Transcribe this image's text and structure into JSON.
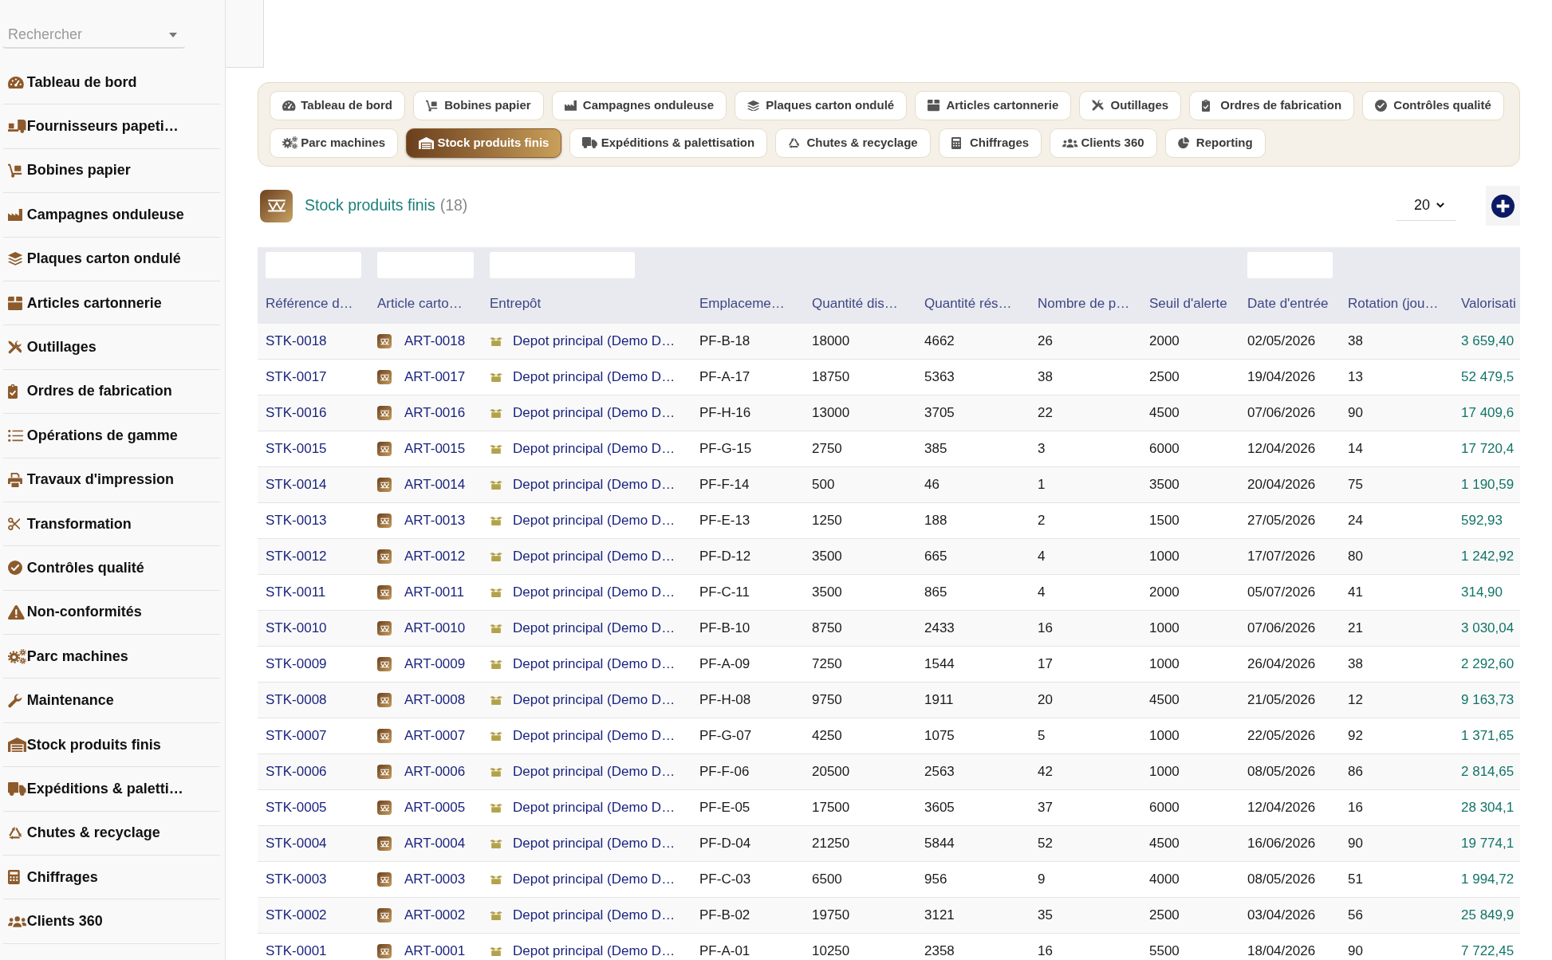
{
  "sidebar": {
    "search": {
      "placeholder": "Rechercher"
    },
    "items": [
      "Tableau de bord",
      "Fournisseurs papeti…",
      "Bobines papier",
      "Campagnes onduleuse",
      "Plaques carton ondulé",
      "Articles cartonnerie",
      "Outillages",
      "Ordres de fabrication",
      "Opérations de gamme",
      "Travaux d'impression",
      "Transformation",
      "Contrôles qualité",
      "Non-conformités",
      "Parc machines",
      "Maintenance",
      "Stock produits finis",
      "Expéditions & paletti…",
      "Chutes & recyclage",
      "Chiffrages",
      "Clients 360"
    ]
  },
  "tabs": [
    {
      "label": "Tableau de bord",
      "selected": false
    },
    {
      "label": "Bobines papier",
      "selected": false
    },
    {
      "label": "Campagnes onduleuse",
      "selected": false
    },
    {
      "label": "Plaques carton ondulé",
      "selected": false
    },
    {
      "label": "Articles cartonnerie",
      "selected": false
    },
    {
      "label": "Outillages",
      "selected": false
    },
    {
      "label": "Ordres de fabrication",
      "selected": false
    },
    {
      "label": "Contrôles qualité",
      "selected": false
    },
    {
      "label": "Parc machines",
      "selected": false
    },
    {
      "label": "Stock produits finis",
      "selected": true
    },
    {
      "label": "Expéditions & palettisation",
      "selected": false
    },
    {
      "label": "Chutes & recyclage",
      "selected": false
    },
    {
      "label": "Chiffrages",
      "selected": false
    },
    {
      "label": "Clients 360",
      "selected": false
    },
    {
      "label": "Reporting",
      "selected": false
    }
  ],
  "header": {
    "title": "Stock produits finis",
    "count": "(18)",
    "page_size": "20"
  },
  "table": {
    "columns": [
      {
        "label": "Référence d…",
        "kind": "link",
        "filter": true
      },
      {
        "label": "Article carto…",
        "kind": "article",
        "filter": true
      },
      {
        "label": "Entrepôt",
        "kind": "depot",
        "filter": true
      },
      {
        "label": "Emplaceme…",
        "kind": "text",
        "filter": false
      },
      {
        "label": "Quantité dis…",
        "kind": "text",
        "filter": false
      },
      {
        "label": "Quantité rés…",
        "kind": "text",
        "filter": false
      },
      {
        "label": "Nombre de p…",
        "kind": "text",
        "filter": false
      },
      {
        "label": "Seuil d'alerte",
        "kind": "text",
        "filter": false
      },
      {
        "label": "Date d'entrée",
        "kind": "text",
        "filter": true
      },
      {
        "label": "Rotation (jou…",
        "kind": "text",
        "filter": false
      },
      {
        "label": "Valorisati",
        "kind": "amount",
        "filter": false
      }
    ],
    "rows": [
      [
        "STK-0018",
        "ART-0018",
        "Depot principal (Demo D…",
        "PF-B-18",
        "18000",
        "4662",
        "26",
        "2000",
        "02/05/2026",
        "38",
        "3 659,40"
      ],
      [
        "STK-0017",
        "ART-0017",
        "Depot principal (Demo D…",
        "PF-A-17",
        "18750",
        "5363",
        "38",
        "2500",
        "19/04/2026",
        "13",
        "52 479,5"
      ],
      [
        "STK-0016",
        "ART-0016",
        "Depot principal (Demo D…",
        "PF-H-16",
        "13000",
        "3705",
        "22",
        "4500",
        "07/06/2026",
        "90",
        "17 409,6"
      ],
      [
        "STK-0015",
        "ART-0015",
        "Depot principal (Demo D…",
        "PF-G-15",
        "2750",
        "385",
        "3",
        "6000",
        "12/04/2026",
        "14",
        "17 720,4"
      ],
      [
        "STK-0014",
        "ART-0014",
        "Depot principal (Demo D…",
        "PF-F-14",
        "500",
        "46",
        "1",
        "3500",
        "20/04/2026",
        "75",
        "1 190,59"
      ],
      [
        "STK-0013",
        "ART-0013",
        "Depot principal (Demo D…",
        "PF-E-13",
        "1250",
        "188",
        "2",
        "1500",
        "27/05/2026",
        "24",
        "592,93"
      ],
      [
        "STK-0012",
        "ART-0012",
        "Depot principal (Demo D…",
        "PF-D-12",
        "3500",
        "665",
        "4",
        "1000",
        "17/07/2026",
        "80",
        "1 242,92"
      ],
      [
        "STK-0011",
        "ART-0011",
        "Depot principal (Demo D…",
        "PF-C-11",
        "3500",
        "865",
        "4",
        "2000",
        "05/07/2026",
        "41",
        "314,90"
      ],
      [
        "STK-0010",
        "ART-0010",
        "Depot principal (Demo D…",
        "PF-B-10",
        "8750",
        "2433",
        "16",
        "1000",
        "07/06/2026",
        "21",
        "3 030,04"
      ],
      [
        "STK-0009",
        "ART-0009",
        "Depot principal (Demo D…",
        "PF-A-09",
        "7250",
        "1544",
        "17",
        "1000",
        "26/04/2026",
        "38",
        "2 292,60"
      ],
      [
        "STK-0008",
        "ART-0008",
        "Depot principal (Demo D…",
        "PF-H-08",
        "9750",
        "1911",
        "20",
        "4500",
        "21/05/2026",
        "12",
        "9 163,73"
      ],
      [
        "STK-0007",
        "ART-0007",
        "Depot principal (Demo D…",
        "PF-G-07",
        "4250",
        "1075",
        "5",
        "1000",
        "22/05/2026",
        "92",
        "1 371,65"
      ],
      [
        "STK-0006",
        "ART-0006",
        "Depot principal (Demo D…",
        "PF-F-06",
        "20500",
        "2563",
        "42",
        "1000",
        "08/05/2026",
        "86",
        "2 814,65"
      ],
      [
        "STK-0005",
        "ART-0005",
        "Depot principal (Demo D…",
        "PF-E-05",
        "17500",
        "3605",
        "37",
        "6000",
        "12/04/2026",
        "16",
        "28 304,1"
      ],
      [
        "STK-0004",
        "ART-0004",
        "Depot principal (Demo D…",
        "PF-D-04",
        "21250",
        "5844",
        "52",
        "4500",
        "16/06/2026",
        "90",
        "19 774,1"
      ],
      [
        "STK-0003",
        "ART-0003",
        "Depot principal (Demo D…",
        "PF-C-03",
        "6500",
        "956",
        "9",
        "4000",
        "08/05/2026",
        "51",
        "1 994,72"
      ],
      [
        "STK-0002",
        "ART-0002",
        "Depot principal (Demo D…",
        "PF-B-02",
        "19750",
        "3121",
        "35",
        "2500",
        "03/04/2026",
        "56",
        "25 849,9"
      ],
      [
        "STK-0001",
        "ART-0001",
        "Depot principal (Demo D…",
        "PF-A-01",
        "10250",
        "2358",
        "16",
        "5500",
        "18/04/2026",
        "90",
        "7 722,45"
      ]
    ]
  }
}
